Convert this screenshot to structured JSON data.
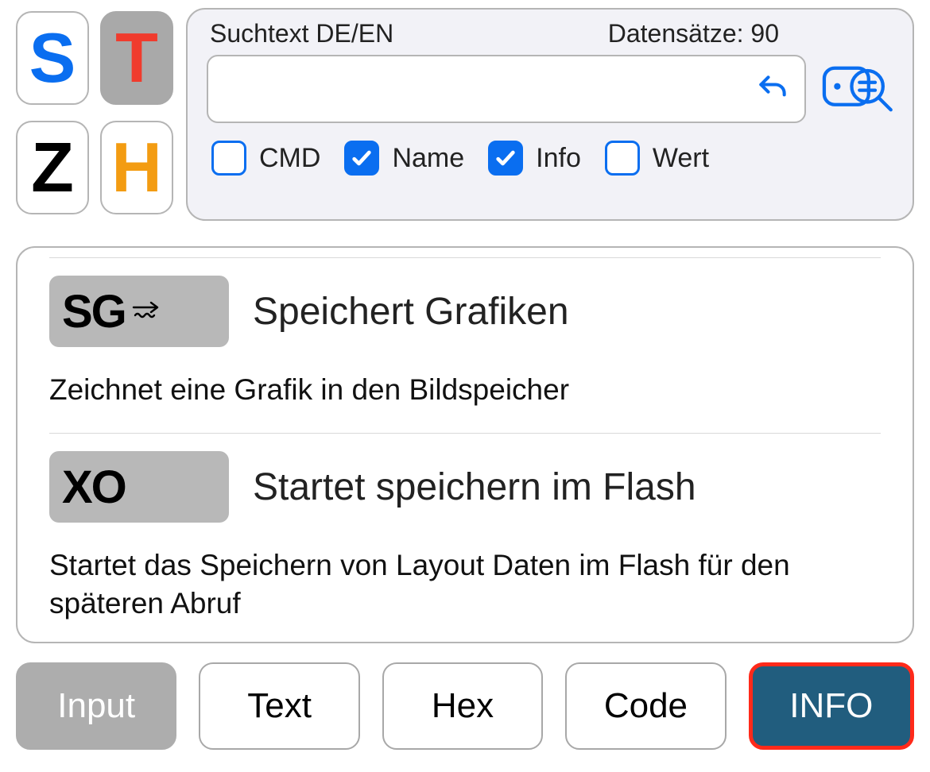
{
  "letters": {
    "s": "S",
    "t": "T",
    "z": "Z",
    "h": "H"
  },
  "search": {
    "label_left": "Suchtext DE/EN",
    "label_right": "Datensätze: 90",
    "value": "",
    "filters": {
      "cmd": {
        "label": "CMD",
        "checked": false
      },
      "name": {
        "label": "Name",
        "checked": true
      },
      "info": {
        "label": "Info",
        "checked": true
      },
      "wert": {
        "label": "Wert",
        "checked": false
      }
    }
  },
  "items": [
    {
      "code": "SG",
      "has_arrow": true,
      "title": "Speichert Grafiken",
      "desc": "Zeichnet eine Grafik in den Bildspeicher"
    },
    {
      "code": "XO",
      "has_arrow": false,
      "title": "Startet speichern im Flash",
      "desc": "Startet das Speichern von Layout Daten im Flash für den späteren Abruf"
    }
  ],
  "tabs": {
    "input": "Input",
    "text": "Text",
    "hex": "Hex",
    "code": "Code",
    "info": "INFO"
  }
}
